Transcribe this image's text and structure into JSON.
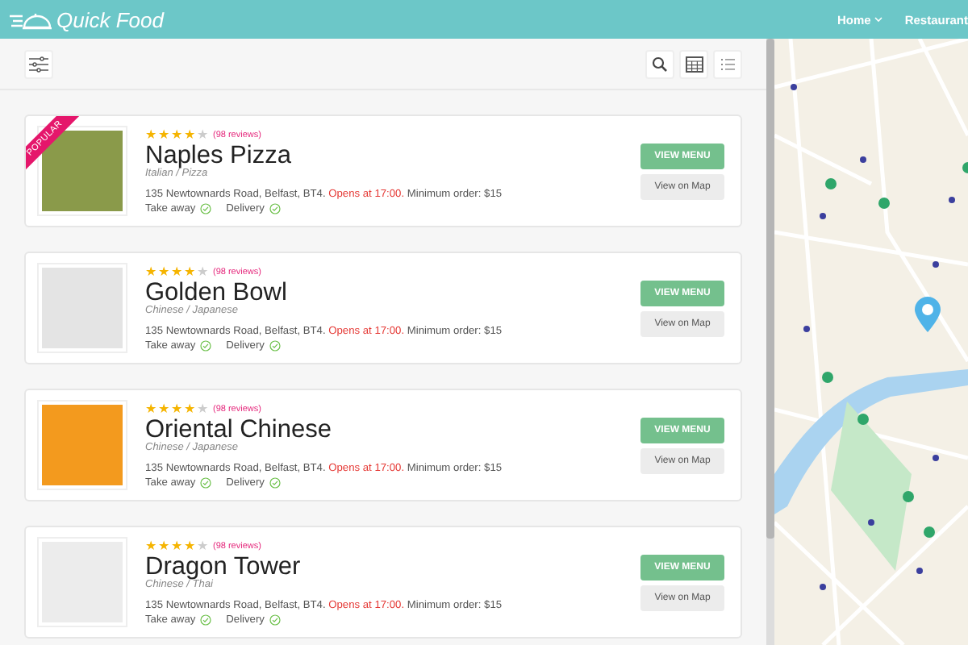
{
  "header": {
    "brand": "Quick Food",
    "nav": [
      {
        "label": "Home",
        "dropdown": true
      },
      {
        "label": "Restaurant",
        "dropdown": false
      }
    ]
  },
  "toolbar": {
    "views": [
      {
        "kind": "search"
      },
      {
        "kind": "grid"
      },
      {
        "kind": "list"
      }
    ]
  },
  "restaurants": [
    {
      "name": "Naples Pizza",
      "popular": true,
      "badge": "POPULAR",
      "stars": 4,
      "reviews": "(98 reviews)",
      "cuisine": "Italian / Pizza",
      "address": "135 Newtownards Road, Belfast, BT4.",
      "hours": "Opens at 17:00.",
      "minimum": "Minimum order: $15",
      "color": "#8a9a4a",
      "services": [
        {
          "label": "Take away",
          "available": true
        },
        {
          "label": "Delivery",
          "available": true
        }
      ],
      "buttons": [
        {
          "kind": "primary",
          "label": "VIEW MENU"
        },
        {
          "kind": "secondary",
          "label": "View on Map"
        }
      ]
    },
    {
      "name": "Golden Bowl",
      "popular": false,
      "stars": 4,
      "reviews": "(98 reviews)",
      "cuisine": "Chinese / Japanese",
      "address": "135 Newtownards Road, Belfast, BT4.",
      "hours": "Opens at 17:00.",
      "minimum": "Minimum order: $15",
      "color": "#e4e4e4",
      "services": [
        {
          "label": "Take away",
          "available": true
        },
        {
          "label": "Delivery",
          "available": true
        }
      ],
      "buttons": [
        {
          "kind": "primary",
          "label": "VIEW MENU"
        },
        {
          "kind": "secondary",
          "label": "View on Map"
        }
      ]
    },
    {
      "name": "Oriental Chinese",
      "popular": false,
      "stars": 4,
      "reviews": "(98 reviews)",
      "cuisine": "Chinese / Japanese",
      "address": "135 Newtownards Road, Belfast, BT4.",
      "hours": "Opens at 17:00.",
      "minimum": "Minimum order: $15",
      "color": "#f39a1e",
      "services": [
        {
          "label": "Take away",
          "available": true
        },
        {
          "label": "Delivery",
          "available": true
        }
      ],
      "buttons": [
        {
          "kind": "primary",
          "label": "VIEW MENU"
        },
        {
          "kind": "secondary",
          "label": "View on Map"
        }
      ]
    },
    {
      "name": "Dragon Tower",
      "popular": false,
      "stars": 4,
      "reviews": "(98 reviews)",
      "cuisine": "Chinese / Thai",
      "address": "135 Newtownards Road, Belfast, BT4.",
      "hours": "Opens at 17:00.",
      "minimum": "Minimum order: $15",
      "color": "#ececec",
      "services": [
        {
          "label": "Take away",
          "available": true
        },
        {
          "label": "Delivery",
          "available": true
        }
      ],
      "buttons": [
        {
          "kind": "primary",
          "label": "VIEW MENU"
        },
        {
          "kind": "secondary",
          "label": "View on Map"
        }
      ]
    }
  ]
}
